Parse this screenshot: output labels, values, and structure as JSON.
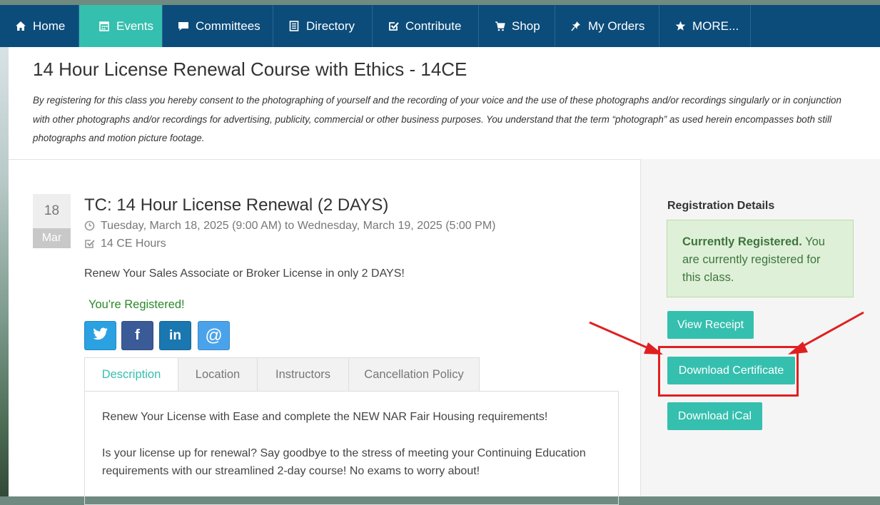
{
  "nav": {
    "items": [
      {
        "label": "Home",
        "icon": "home-icon"
      },
      {
        "label": "Events",
        "icon": "calendar-icon",
        "active": true
      },
      {
        "label": "Committees",
        "icon": "chat-bubble-icon"
      },
      {
        "label": "Directory",
        "icon": "book-icon"
      },
      {
        "label": "Contribute",
        "icon": "check-square-icon"
      },
      {
        "label": "Shop",
        "icon": "cart-icon"
      },
      {
        "label": "My Orders",
        "icon": "pin-icon"
      },
      {
        "label": "MORE...",
        "icon": "star-icon"
      }
    ]
  },
  "page": {
    "title": "14 Hour License Renewal Course with Ethics - 14CE",
    "consent": "By registering for this class you hereby consent to the photographing of yourself and the recording of your voice and the use of these photographs and/or recordings singularly or in conjunction with other photographs and/or recordings for advertising, publicity, commercial or other business purposes. You understand that the term “photograph” as used herein encompasses both still photographs and motion picture footage."
  },
  "event": {
    "day": "18",
    "month": "Mar",
    "title": "TC: 14 Hour License Renewal (2 DAYS)",
    "datetime": "Tuesday, March 18, 2025 (9:00 AM) to Wednesday, March 19, 2025 (5:00 PM)",
    "ce_hours": "14 CE Hours",
    "intro": "Renew Your Sales Associate or Broker License in only 2 DAYS!",
    "registered_text": "You're Registered!",
    "social": [
      {
        "name": "twitter",
        "glyph": "•"
      },
      {
        "name": "facebook",
        "glyph": "f"
      },
      {
        "name": "linkedin",
        "glyph": "in"
      },
      {
        "name": "email",
        "glyph": "@"
      }
    ]
  },
  "tabs": [
    {
      "label": "Description",
      "active": true
    },
    {
      "label": "Location"
    },
    {
      "label": "Instructors"
    },
    {
      "label": "Cancellation Policy"
    }
  ],
  "description": {
    "p1": "Renew Your License with Ease and complete the NEW NAR Fair Housing requirements!",
    "p2": "Is your license up for renewal? Say goodbye to the stress of meeting your Continuing Education requirements with our streamlined 2-day course! No exams to worry about!"
  },
  "sidebar": {
    "title": "Registration Details",
    "status_bold": "Currently Registered.",
    "status_text": " You are currently registered for this class.",
    "view_receipt": "View Receipt",
    "download_certificate": "Download Certificate",
    "download_ical": "Download iCal"
  },
  "colors": {
    "nav_bg": "#0b4c7b",
    "accent": "#35bfae",
    "success_bg": "#dff0d8",
    "annotation_red": "#e02020"
  }
}
